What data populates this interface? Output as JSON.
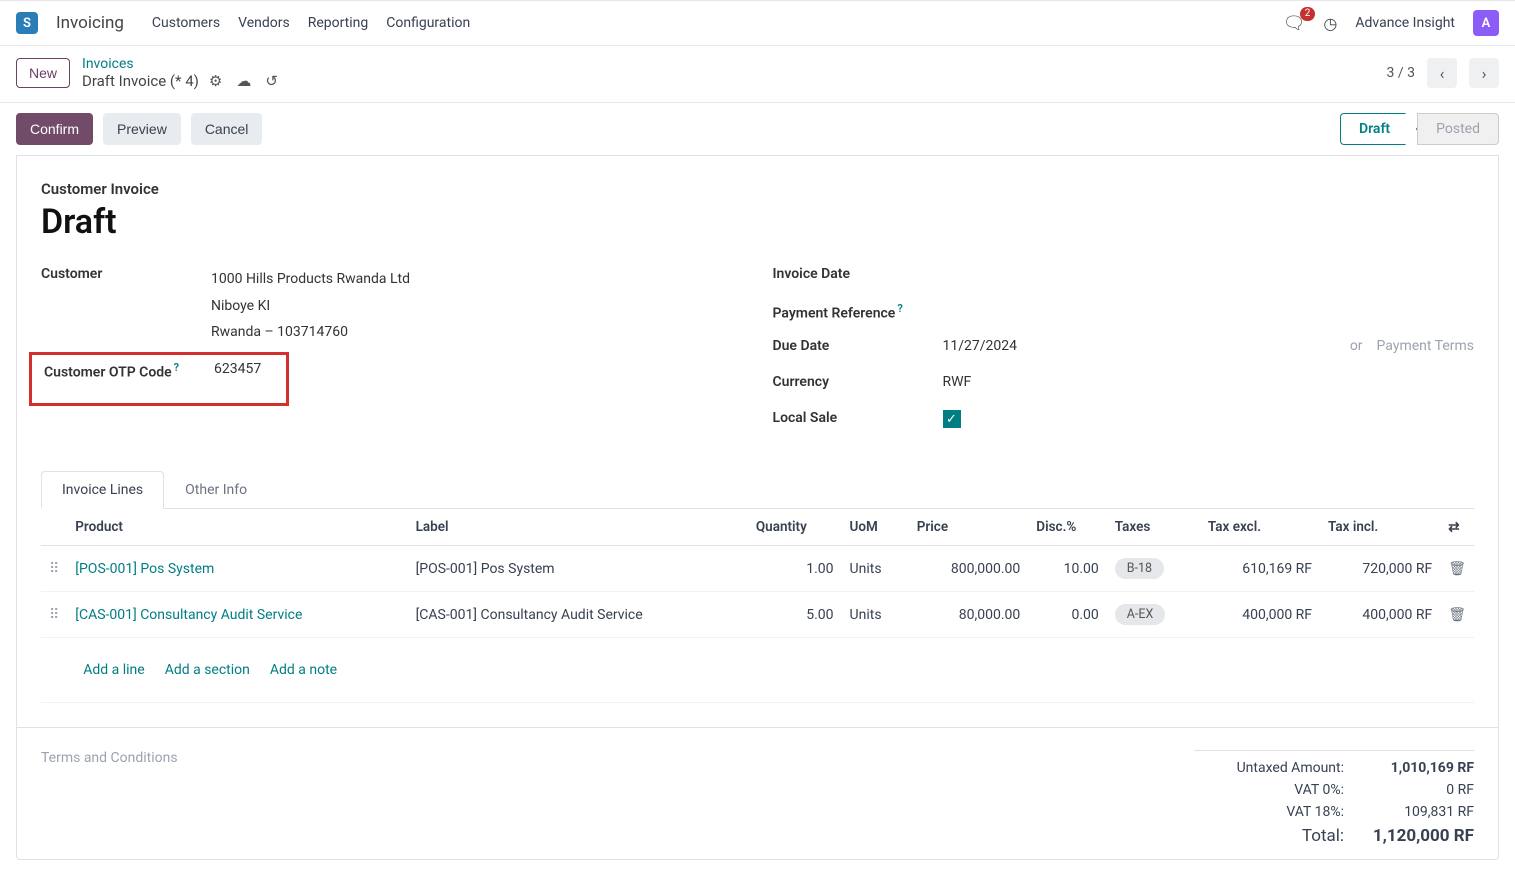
{
  "app": {
    "title": "Invoicing",
    "icon_letter": "S",
    "nav": [
      "Customers",
      "Vendors",
      "Reporting",
      "Configuration"
    ],
    "messages_badge": "2",
    "advance_insight": "Advance Insight",
    "user_initial": "A"
  },
  "breadcrumb": {
    "new_btn": "New",
    "parent": "Invoices",
    "current": "Draft Invoice (* 4)",
    "pager": "3 / 3"
  },
  "actions": {
    "confirm": "Confirm",
    "preview": "Preview",
    "cancel": "Cancel"
  },
  "status": {
    "draft": "Draft",
    "posted": "Posted"
  },
  "form": {
    "doc_type": "Customer Invoice",
    "title": "Draft",
    "customer_label": "Customer",
    "customer_name": "1000 Hills Products Rwanda Ltd",
    "customer_addr1": "Niboye KI",
    "customer_addr2": "Rwanda – 103714760",
    "otp_label": "Customer OTP Code",
    "otp_value": "623457",
    "invoice_date_label": "Invoice Date",
    "invoice_date_value": "",
    "payment_ref_label": "Payment Reference",
    "due_date_label": "Due Date",
    "due_date_value": "11/27/2024",
    "or_text": "or",
    "payment_terms_placeholder": "Payment Terms",
    "currency_label": "Currency",
    "currency_value": "RWF",
    "local_sale_label": "Local Sale"
  },
  "tabs": {
    "invoice_lines": "Invoice Lines",
    "other_info": "Other Info"
  },
  "table": {
    "headers": {
      "product": "Product",
      "label": "Label",
      "quantity": "Quantity",
      "uom": "UoM",
      "price": "Price",
      "disc": "Disc.%",
      "taxes": "Taxes",
      "tax_excl": "Tax excl.",
      "tax_incl": "Tax incl."
    },
    "rows": [
      {
        "product": "[POS-001] Pos System",
        "label": "[POS-001] Pos System",
        "quantity": "1.00",
        "uom": "Units",
        "price": "800,000.00",
        "disc": "10.00",
        "tax": "B-18",
        "tax_excl": "610,169 RF",
        "tax_incl": "720,000 RF"
      },
      {
        "product": "[CAS-001] Consultancy Audit Service",
        "label": "[CAS-001] Consultancy Audit Service",
        "quantity": "5.00",
        "uom": "Units",
        "price": "80,000.00",
        "disc": "0.00",
        "tax": "A-EX",
        "tax_excl": "400,000 RF",
        "tax_incl": "400,000 RF"
      }
    ],
    "add_line": "Add a line",
    "add_section": "Add a section",
    "add_note": "Add a note"
  },
  "footer": {
    "terms_placeholder": "Terms and Conditions",
    "untaxed_label": "Untaxed Amount:",
    "untaxed_value": "1,010,169 RF",
    "vat0_label": "VAT 0%:",
    "vat0_value": "0 RF",
    "vat18_label": "VAT 18%:",
    "vat18_value": "109,831 RF",
    "total_label": "Total:",
    "total_value": "1,120,000 RF"
  }
}
